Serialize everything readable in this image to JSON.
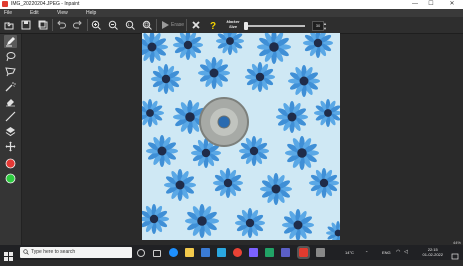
{
  "window": {
    "title": "IMG_20220204.JPEG - Inpaint",
    "minimize_glyph": "—",
    "maximize_glyph": "☐",
    "close_glyph": "✕"
  },
  "menu": {
    "items": [
      "File",
      "Edit",
      "View",
      "Help"
    ]
  },
  "toolbar": {
    "erase_label": "Erase",
    "marker_size_label_1": "Marker",
    "marker_size_label_2": "Size",
    "marker_size_value": "30",
    "marker_size_fraction": 0.02,
    "spin_up": "▲",
    "spin_down": "▼"
  },
  "left_tools": [
    "marker-tool",
    "lasso-tool",
    "polygon-lasso-tool",
    "magic-wand-tool",
    "eraser-tool",
    "line-tool",
    "layers-tool",
    "move-tool",
    "red-color",
    "green-color"
  ],
  "status": {
    "zoom": "44%"
  },
  "taskbar": {
    "search_placeholder": "Type here to search",
    "weather": "14°C",
    "language": "ENG",
    "time": "22:15",
    "date": "01-02-2022"
  },
  "colors": {
    "accent_red": "#e53935",
    "accent_green": "#2ecc40",
    "flower_blue": "#3f8fd6",
    "flower_center": "#1f2c4a"
  }
}
